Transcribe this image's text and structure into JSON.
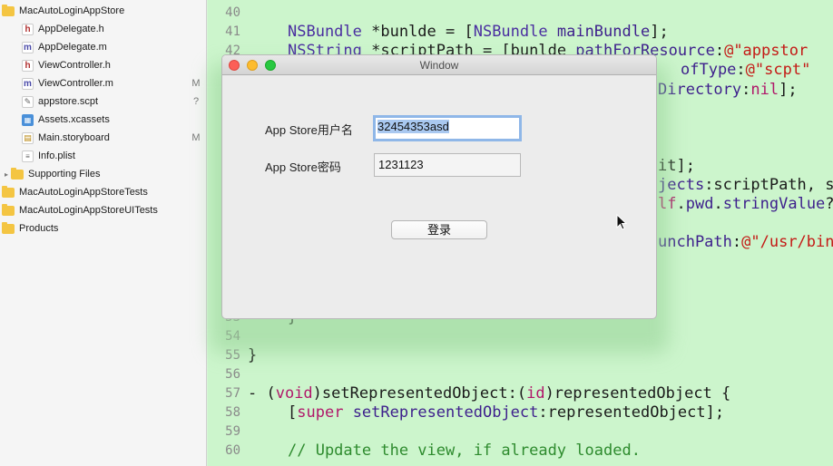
{
  "navigator": {
    "items": [
      {
        "label": "MacAutoLoginAppStore",
        "icon": "folder-icon",
        "status": ""
      },
      {
        "label": "AppDelegate.h",
        "icon": "h-file-icon",
        "status": ""
      },
      {
        "label": "AppDelegate.m",
        "icon": "m-file-icon",
        "status": ""
      },
      {
        "label": "ViewController.h",
        "icon": "h-file-icon",
        "status": ""
      },
      {
        "label": "ViewController.m",
        "icon": "m-file-icon",
        "status": "M"
      },
      {
        "label": "appstore.scpt",
        "icon": "script-file-icon",
        "status": "?"
      },
      {
        "label": "Assets.xcassets",
        "icon": "assets-icon",
        "status": ""
      },
      {
        "label": "Main.storyboard",
        "icon": "storyboard-icon",
        "status": "M"
      },
      {
        "label": "Info.plist",
        "icon": "plist-icon",
        "status": ""
      },
      {
        "label": "Supporting Files",
        "icon": "folder-icon",
        "status": ""
      },
      {
        "label": "MacAutoLoginAppStoreTests",
        "icon": "folder-icon",
        "status": ""
      },
      {
        "label": "MacAutoLoginAppStoreUITests",
        "icon": "folder-icon",
        "status": ""
      },
      {
        "label": "Products",
        "icon": "folder-icon",
        "status": ""
      }
    ]
  },
  "editor": {
    "line_numbers": [
      "40",
      "41",
      "42",
      "53",
      "54",
      "55",
      "56",
      "57",
      "58",
      "59",
      "60"
    ],
    "fragments": {
      "l41_a": "NSBundle",
      "l41_b": " *bunlde = [",
      "l41_c": "NSBundle",
      "l41_d": " ",
      "l41_e": "mainBundle",
      "l41_f": "];",
      "l42_a": "NSString",
      "l42_b": " *scriptPath = [bunlde ",
      "l42_c": "pathForResource",
      "l42_d": ":",
      "l42_e": "@\"appstor",
      "l43_a": "ofType",
      "l43_b": ":",
      "l43_c": "@\"scpt\"",
      "l44_a": "Directory",
      "l44_b": ":",
      "l44_c": "nil",
      "l44_d": "];",
      "l47_a": "it];",
      "l48_a": "jects",
      "l48_b": ":scriptPath, s",
      "l49_a": "lf",
      "l49_b": ".",
      "l49_c": "pwd",
      "l49_d": ".",
      "l49_e": "stringValue",
      "l49_f": "?",
      "l51_a": "unchPath",
      "l51_b": ":",
      "l51_c": "@\"/usr/bin",
      "l53_a": "}",
      "l55_a": "}",
      "l57_a": "- (",
      "l57_b": "void",
      "l57_c": ")setRepresentedObject:(",
      "l57_d": "id",
      "l57_e": ")representedObject {",
      "l58_a": "[",
      "l58_b": "super",
      "l58_c": " ",
      "l58_d": "setRepresentedObject",
      "l58_e": ":representedObject];",
      "l60_a": "// Update the view, if already loaded."
    },
    "colors": {
      "keyword": "#b0186a",
      "type": "#4a2ea0",
      "string": "#c41a16",
      "comment": "#2e8b2e"
    }
  },
  "window": {
    "title": "Window",
    "username_label": "App Store用户名",
    "username_value": "32454353asd",
    "password_label": "App Store密码",
    "password_value": "1231123",
    "login_label": "登录"
  }
}
